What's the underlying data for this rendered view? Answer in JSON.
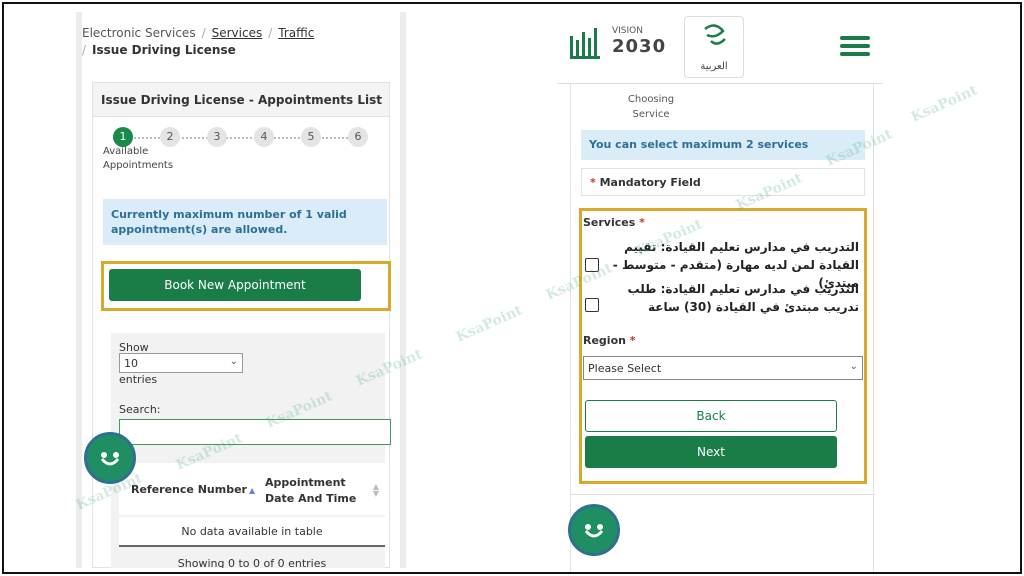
{
  "left": {
    "breadcrumb": {
      "root": "Electronic Services",
      "services": "Services",
      "traffic": "Traffic",
      "current": "Issue Driving License"
    },
    "card_title": "Issue Driving License - Appointments List",
    "steps": [
      "1",
      "2",
      "3",
      "4",
      "5",
      "6"
    ],
    "step_label": "Available Appointments",
    "alert": "Currently maximum number of 1 valid appointment(s) are allowed.",
    "book_button": "Book New Appointment",
    "show_label": "Show",
    "entries_value": "10",
    "entries_label": "entries",
    "search_label": "Search:",
    "columns": [
      "Reference Number",
      "Appointment Date And Time"
    ],
    "no_data": "No data available in table",
    "showing": "Showing 0 to 0 of 0 entries"
  },
  "right": {
    "vision_label": "VISION",
    "vision_year": "2030",
    "language": "العربية",
    "choosing_service": "Choosing Service",
    "alert": "You can select maximum 2 services",
    "mandatory": "Mandatory Field",
    "services_label": "Services",
    "options": [
      "التدريب في مدارس تعليم القيادة: تقييم القيادة لمن لديه مهارة (متقدم - متوسط - مبتدئ)",
      "التدريب في مدارس تعليم القيادة: طلب تدريب مبتدئ في القيادة (30) ساعة"
    ],
    "region_label": "Region",
    "region_value": "Please Select",
    "back_button": "Back",
    "next_button": "Next"
  },
  "watermark": "KsaPoint",
  "colors": {
    "primary": "#1a7d48",
    "highlight": "#d9a92b",
    "alert_bg": "#d9ecf7"
  }
}
